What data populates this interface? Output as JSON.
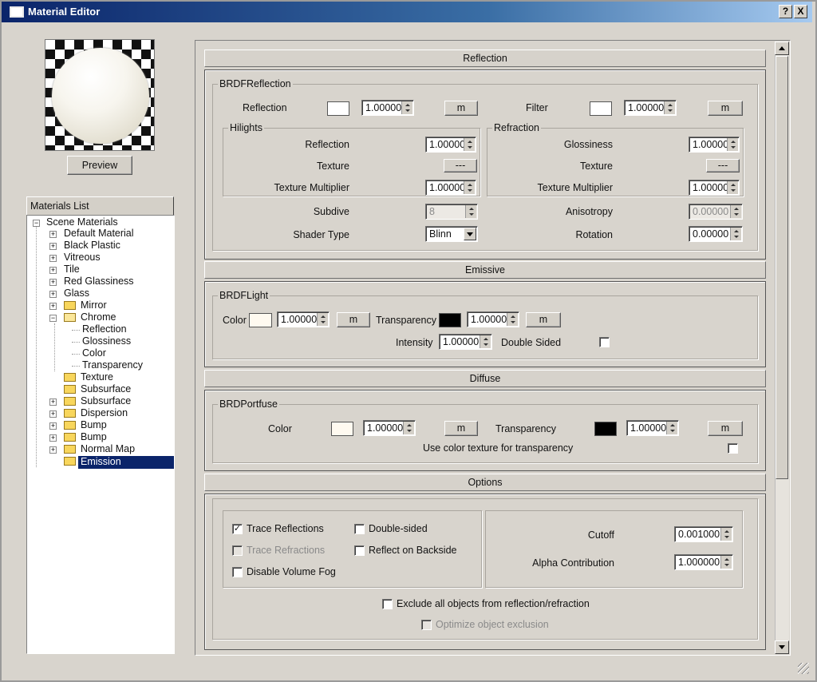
{
  "window": {
    "title": "Material Editor",
    "help_label": "?",
    "close_label": "X"
  },
  "preview": {
    "button_label": "Preview"
  },
  "materials_list": {
    "header": "Materials List",
    "root": "Scene Materials",
    "items": [
      "Default Material",
      "Black Plastic",
      "Vitreous",
      "Tile",
      "Red Glassiness",
      "Glass",
      "Mirror",
      "Chrome",
      "Reflection",
      "Glossiness",
      "Color",
      "Transparency",
      "Texture",
      "Subsurface",
      "Subsurface",
      "Dispersion",
      "Bump",
      "Bump",
      "Normal Map",
      "Emission"
    ],
    "selected": "Emission"
  },
  "reflection": {
    "section": "Reflection",
    "group": "BRDFReflection",
    "reflection_label": "Reflection",
    "reflection_value": "1.00000",
    "m_label": "m",
    "filter_label": "Filter",
    "filter_value": "1.00000",
    "hilights": {
      "group": "Hilights",
      "reflection_label": "Reflection",
      "reflection_value": "1.00000",
      "texture_label": "Texture",
      "texture_button": "---",
      "multiplier_label": "Texture Multiplier",
      "multiplier_value": "1.00000"
    },
    "refraction": {
      "group": "Refraction",
      "glossiness_label": "Glossiness",
      "glossiness_value": "1.00000",
      "texture_label": "Texture",
      "texture_button": "---",
      "multiplier_label": "Texture Multiplier",
      "multiplier_value": "1.00000"
    },
    "subdivs_label": "Subdive",
    "subdivs_value": "8",
    "anisotropy_label": "Anisotropy",
    "anisotropy_value": "0.00000",
    "shader_label": "Shader Type",
    "shader_value": "Blinn",
    "rotation_label": "Rotation",
    "rotation_value": "0.00000"
  },
  "emissive": {
    "section": "Emissive",
    "group": "BRDFLight",
    "color_label": "Color",
    "color_value": "1.00000",
    "m_label": "m",
    "transparency_label": "Transparency",
    "transparency_value": "1.00000",
    "intensity_label": "Intensity",
    "intensity_value": "1.00000",
    "double_sided_label": "Double Sided"
  },
  "diffuse": {
    "section": "Diffuse",
    "group": "BRDPortfuse",
    "color_label": "Color",
    "color_value": "1.00000",
    "m_label": "m",
    "transparency_label": "Transparency",
    "transparency_value": "1.00000",
    "use_texture_label": "Use color texture for transparency"
  },
  "options": {
    "section": "Options",
    "trace_reflections": "Trace Reflections",
    "trace_refractions": "Trace Refractions",
    "disable_volume_fog": "Disable Volume Fog",
    "double_sided": "Double-sided",
    "reflect_backside": "Reflect on Backside",
    "cutoff_label": "Cutoff",
    "cutoff_value": "0.001000",
    "alpha_label": "Alpha Contribution",
    "alpha_value": "1.000000",
    "exclude_label": "Exclude all objects from reflection/refraction",
    "optimize_label": "Optimize object exclusion",
    "check_mark": "✓"
  },
  "colors": {
    "title_start": "#0a246a",
    "selection": "#0a246a",
    "folder": "#f8d65c"
  }
}
